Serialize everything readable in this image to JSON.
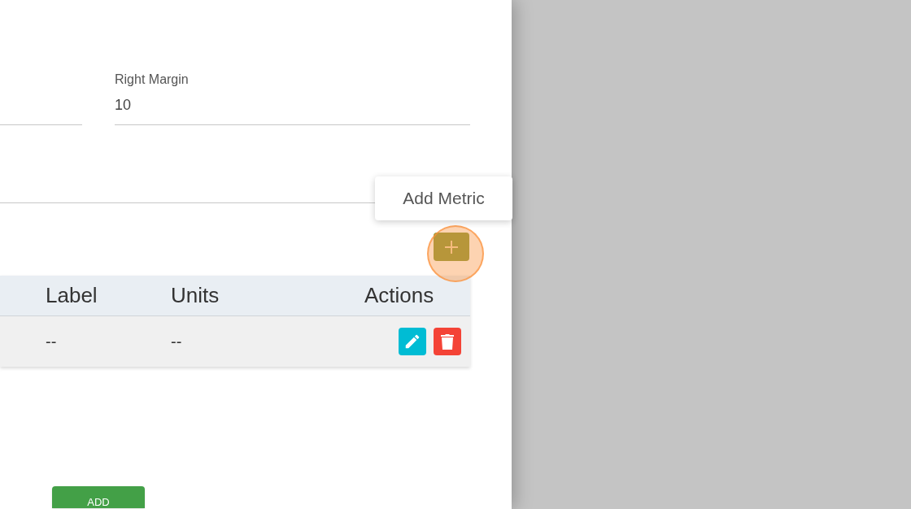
{
  "fields": [
    {
      "label": "Right Margin",
      "value": "10"
    }
  ],
  "tooltip": {
    "text": "Add Metric"
  },
  "table": {
    "columns": [
      "Label",
      "Units",
      "Actions"
    ],
    "rows": [
      {
        "cells": [
          "--",
          "--"
        ]
      }
    ]
  },
  "submit_button": {
    "label": "ADD"
  }
}
